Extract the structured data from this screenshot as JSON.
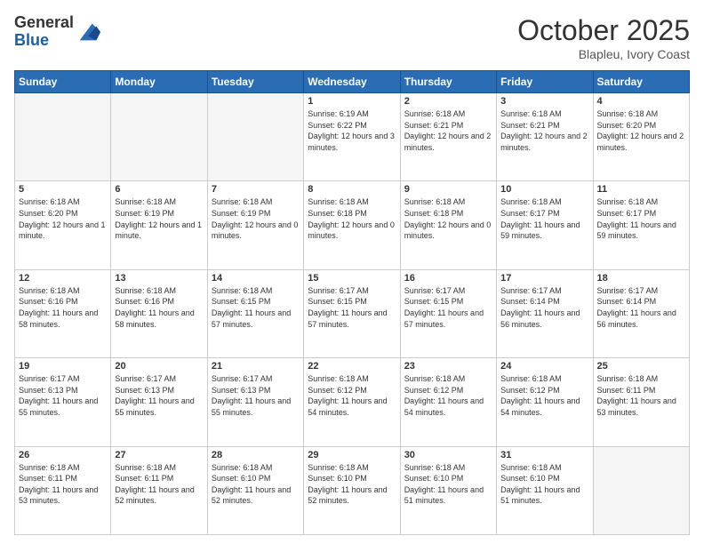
{
  "header": {
    "logo_general": "General",
    "logo_blue": "Blue",
    "month_title": "October 2025",
    "location": "Blapleu, Ivory Coast"
  },
  "days_of_week": [
    "Sunday",
    "Monday",
    "Tuesday",
    "Wednesday",
    "Thursday",
    "Friday",
    "Saturday"
  ],
  "weeks": [
    [
      {
        "num": "",
        "info": ""
      },
      {
        "num": "",
        "info": ""
      },
      {
        "num": "",
        "info": ""
      },
      {
        "num": "1",
        "info": "Sunrise: 6:19 AM\nSunset: 6:22 PM\nDaylight: 12 hours and 3 minutes."
      },
      {
        "num": "2",
        "info": "Sunrise: 6:18 AM\nSunset: 6:21 PM\nDaylight: 12 hours and 2 minutes."
      },
      {
        "num": "3",
        "info": "Sunrise: 6:18 AM\nSunset: 6:21 PM\nDaylight: 12 hours and 2 minutes."
      },
      {
        "num": "4",
        "info": "Sunrise: 6:18 AM\nSunset: 6:20 PM\nDaylight: 12 hours and 2 minutes."
      }
    ],
    [
      {
        "num": "5",
        "info": "Sunrise: 6:18 AM\nSunset: 6:20 PM\nDaylight: 12 hours and 1 minute."
      },
      {
        "num": "6",
        "info": "Sunrise: 6:18 AM\nSunset: 6:19 PM\nDaylight: 12 hours and 1 minute."
      },
      {
        "num": "7",
        "info": "Sunrise: 6:18 AM\nSunset: 6:19 PM\nDaylight: 12 hours and 0 minutes."
      },
      {
        "num": "8",
        "info": "Sunrise: 6:18 AM\nSunset: 6:18 PM\nDaylight: 12 hours and 0 minutes."
      },
      {
        "num": "9",
        "info": "Sunrise: 6:18 AM\nSunset: 6:18 PM\nDaylight: 12 hours and 0 minutes."
      },
      {
        "num": "10",
        "info": "Sunrise: 6:18 AM\nSunset: 6:17 PM\nDaylight: 11 hours and 59 minutes."
      },
      {
        "num": "11",
        "info": "Sunrise: 6:18 AM\nSunset: 6:17 PM\nDaylight: 11 hours and 59 minutes."
      }
    ],
    [
      {
        "num": "12",
        "info": "Sunrise: 6:18 AM\nSunset: 6:16 PM\nDaylight: 11 hours and 58 minutes."
      },
      {
        "num": "13",
        "info": "Sunrise: 6:18 AM\nSunset: 6:16 PM\nDaylight: 11 hours and 58 minutes."
      },
      {
        "num": "14",
        "info": "Sunrise: 6:18 AM\nSunset: 6:15 PM\nDaylight: 11 hours and 57 minutes."
      },
      {
        "num": "15",
        "info": "Sunrise: 6:17 AM\nSunset: 6:15 PM\nDaylight: 11 hours and 57 minutes."
      },
      {
        "num": "16",
        "info": "Sunrise: 6:17 AM\nSunset: 6:15 PM\nDaylight: 11 hours and 57 minutes."
      },
      {
        "num": "17",
        "info": "Sunrise: 6:17 AM\nSunset: 6:14 PM\nDaylight: 11 hours and 56 minutes."
      },
      {
        "num": "18",
        "info": "Sunrise: 6:17 AM\nSunset: 6:14 PM\nDaylight: 11 hours and 56 minutes."
      }
    ],
    [
      {
        "num": "19",
        "info": "Sunrise: 6:17 AM\nSunset: 6:13 PM\nDaylight: 11 hours and 55 minutes."
      },
      {
        "num": "20",
        "info": "Sunrise: 6:17 AM\nSunset: 6:13 PM\nDaylight: 11 hours and 55 minutes."
      },
      {
        "num": "21",
        "info": "Sunrise: 6:17 AM\nSunset: 6:13 PM\nDaylight: 11 hours and 55 minutes."
      },
      {
        "num": "22",
        "info": "Sunrise: 6:18 AM\nSunset: 6:12 PM\nDaylight: 11 hours and 54 minutes."
      },
      {
        "num": "23",
        "info": "Sunrise: 6:18 AM\nSunset: 6:12 PM\nDaylight: 11 hours and 54 minutes."
      },
      {
        "num": "24",
        "info": "Sunrise: 6:18 AM\nSunset: 6:12 PM\nDaylight: 11 hours and 54 minutes."
      },
      {
        "num": "25",
        "info": "Sunrise: 6:18 AM\nSunset: 6:11 PM\nDaylight: 11 hours and 53 minutes."
      }
    ],
    [
      {
        "num": "26",
        "info": "Sunrise: 6:18 AM\nSunset: 6:11 PM\nDaylight: 11 hours and 53 minutes."
      },
      {
        "num": "27",
        "info": "Sunrise: 6:18 AM\nSunset: 6:11 PM\nDaylight: 11 hours and 52 minutes."
      },
      {
        "num": "28",
        "info": "Sunrise: 6:18 AM\nSunset: 6:10 PM\nDaylight: 11 hours and 52 minutes."
      },
      {
        "num": "29",
        "info": "Sunrise: 6:18 AM\nSunset: 6:10 PM\nDaylight: 11 hours and 52 minutes."
      },
      {
        "num": "30",
        "info": "Sunrise: 6:18 AM\nSunset: 6:10 PM\nDaylight: 11 hours and 51 minutes."
      },
      {
        "num": "31",
        "info": "Sunrise: 6:18 AM\nSunset: 6:10 PM\nDaylight: 11 hours and 51 minutes."
      },
      {
        "num": "",
        "info": ""
      }
    ]
  ]
}
